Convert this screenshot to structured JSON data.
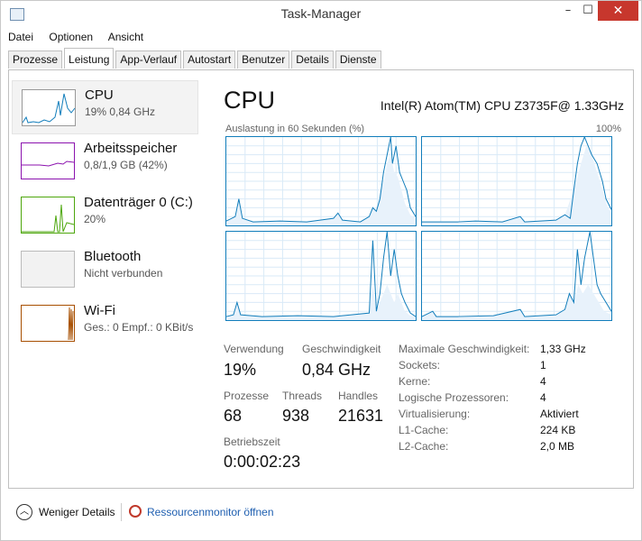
{
  "window": {
    "title": "Task-Manager",
    "minimize": "–",
    "maximize": "☐",
    "close": "✕"
  },
  "menu": [
    "Datei",
    "Optionen",
    "Ansicht"
  ],
  "tabs": [
    "Prozesse",
    "Leistung",
    "App-Verlauf",
    "Autostart",
    "Benutzer",
    "Details",
    "Dienste"
  ],
  "active_tab": "Leistung",
  "sidebar": [
    {
      "name": "CPU",
      "detail": "19%  0,84 GHz",
      "color": "#117dbb"
    },
    {
      "name": "Arbeitsspeicher",
      "detail": "0,8/1,9 GB (42%)",
      "color": "#8b12ae"
    },
    {
      "name": "Datenträger 0 (C:)",
      "detail": "20%",
      "color": "#4da60c"
    },
    {
      "name": "Bluetooth",
      "detail": "Nicht verbunden",
      "color": "#999999"
    },
    {
      "name": "Wi-Fi",
      "detail": "Ges.: 0  Empf.: 0 KBit/s",
      "color": "#a74f01"
    }
  ],
  "main": {
    "title": "CPU",
    "model": "Intel(R) Atom(TM) CPU Z3735F@ 1.33GHz",
    "graph_caption": "Auslastung in 60 Sekunden (%)",
    "graph_max": "100%",
    "stats": {
      "verwendung_label": "Verwendung",
      "verwendung": "19%",
      "geschwindigkeit_label": "Geschwindigkeit",
      "geschwindigkeit": "0,84 GHz",
      "prozesse_label": "Prozesse",
      "prozesse": "68",
      "threads_label": "Threads",
      "threads": "938",
      "handles_label": "Handles",
      "handles": "21631",
      "betriebszeit_label": "Betriebszeit",
      "betriebszeit": "0:00:02:23"
    },
    "info": [
      {
        "label": "Maximale Geschwindigkeit:",
        "value": "1,33 GHz"
      },
      {
        "label": "Sockets:",
        "value": "1"
      },
      {
        "label": "Kerne:",
        "value": "4"
      },
      {
        "label": "Logische Prozessoren:",
        "value": "4"
      },
      {
        "label": "Virtualisierung:",
        "value": "Aktiviert"
      },
      {
        "label": "L1-Cache:",
        "value": "224 KB"
      },
      {
        "label": "L2-Cache:",
        "value": "2,0 MB"
      }
    ]
  },
  "footer": {
    "less_details": "Weniger Details",
    "resource_monitor": "Ressourcenmonitor öffnen"
  }
}
